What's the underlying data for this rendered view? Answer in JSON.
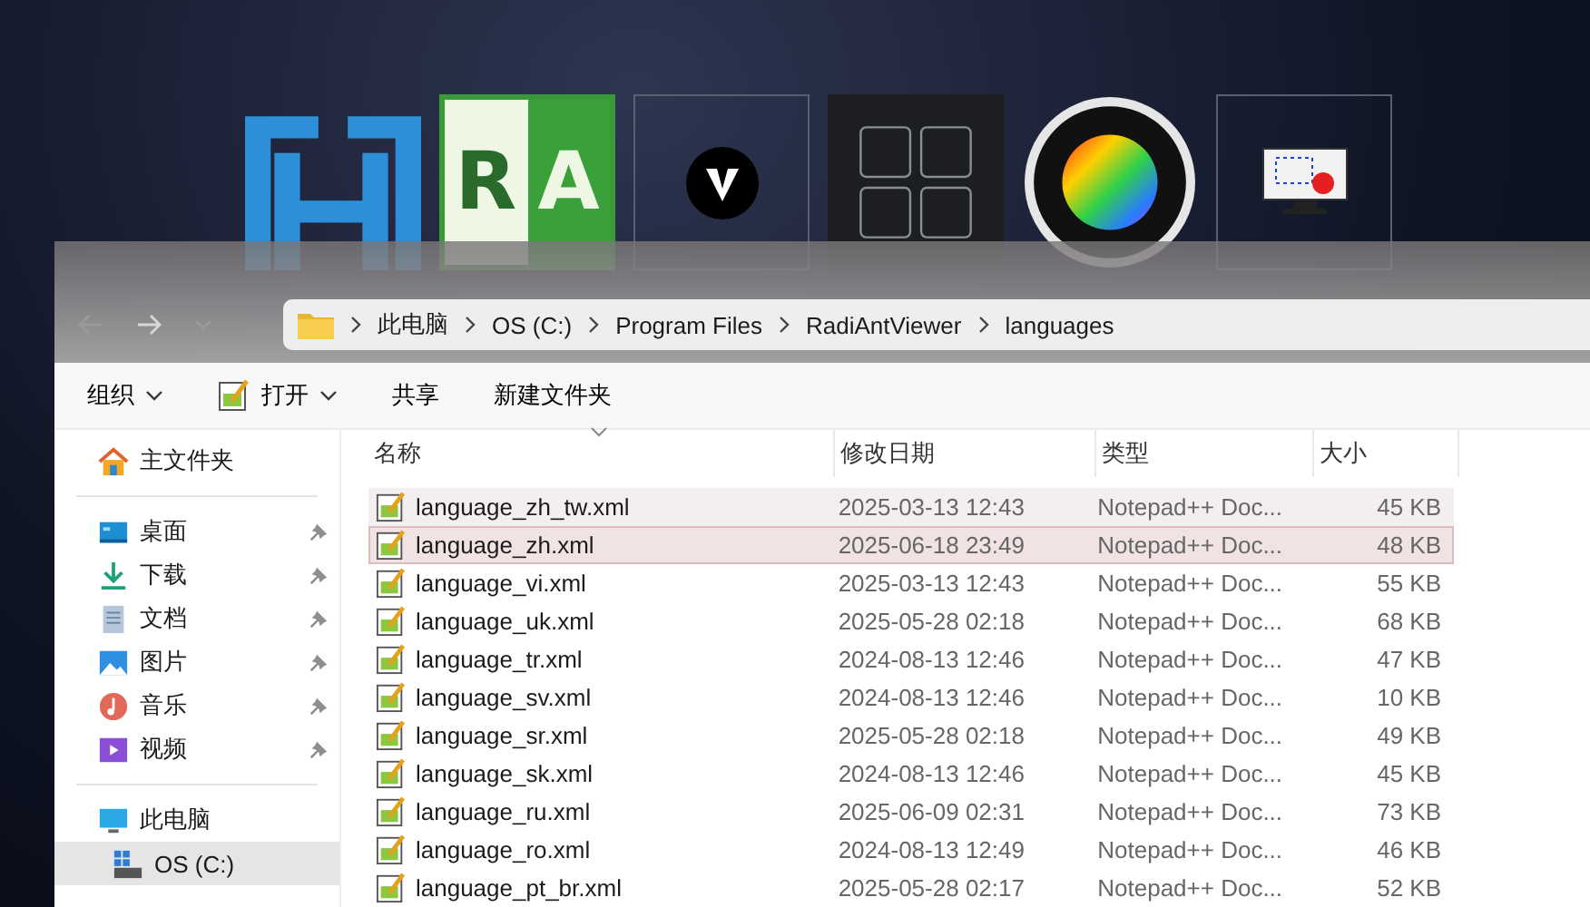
{
  "taskbar_previews": [
    {
      "kind": "h-logo"
    },
    {
      "kind": "ra-logo",
      "text_left": "R",
      "text_right": "A"
    },
    {
      "kind": "v-logo"
    },
    {
      "kind": "grid-logo"
    },
    {
      "kind": "color-wheel"
    },
    {
      "kind": "screen-capture"
    }
  ],
  "address_bar": {
    "crumbs": [
      "此电脑",
      "OS (C:)",
      "Program Files",
      "RadiAntViewer",
      "languages"
    ]
  },
  "toolbar": [
    {
      "label": "组织",
      "kind": "menu"
    },
    {
      "label": "打开",
      "kind": "open"
    },
    {
      "label": "共享",
      "kind": "plain"
    },
    {
      "label": "新建文件夹",
      "kind": "plain"
    }
  ],
  "sidebar": {
    "home": {
      "label": "主文件夹"
    },
    "quick_access": [
      {
        "label": "桌面",
        "kind": "desktop",
        "pinned": true
      },
      {
        "label": "下载",
        "kind": "download",
        "pinned": true
      },
      {
        "label": "文档",
        "kind": "documents",
        "pinned": true
      },
      {
        "label": "图片",
        "kind": "pictures",
        "pinned": true
      },
      {
        "label": "音乐",
        "kind": "music",
        "pinned": true
      },
      {
        "label": "视频",
        "kind": "videos",
        "pinned": true
      }
    ],
    "this_pc": {
      "label": "此电脑",
      "children": [
        {
          "label": "OS (C:)",
          "selected": true
        }
      ]
    }
  },
  "table": {
    "columns": [
      "名称",
      "修改日期",
      "类型",
      "大小"
    ],
    "rows": [
      {
        "name": "language_zh_tw.xml",
        "modified": "2025-03-13 12:43",
        "type": "Notepad++ Doc...",
        "size": "45 KB",
        "selected": false,
        "hovered": true
      },
      {
        "name": "language_zh.xml",
        "modified": "2025-06-18 23:49",
        "type": "Notepad++ Doc...",
        "size": "48 KB",
        "selected": true,
        "hovered": false
      },
      {
        "name": "language_vi.xml",
        "modified": "2025-03-13 12:43",
        "type": "Notepad++ Doc...",
        "size": "55 KB",
        "selected": false,
        "hovered": false
      },
      {
        "name": "language_uk.xml",
        "modified": "2025-05-28 02:18",
        "type": "Notepad++ Doc...",
        "size": "68 KB",
        "selected": false,
        "hovered": false
      },
      {
        "name": "language_tr.xml",
        "modified": "2024-08-13 12:46",
        "type": "Notepad++ Doc...",
        "size": "47 KB",
        "selected": false,
        "hovered": false
      },
      {
        "name": "language_sv.xml",
        "modified": "2024-08-13 12:46",
        "type": "Notepad++ Doc...",
        "size": "10 KB",
        "selected": false,
        "hovered": false
      },
      {
        "name": "language_sr.xml",
        "modified": "2025-05-28 02:18",
        "type": "Notepad++ Doc...",
        "size": "49 KB",
        "selected": false,
        "hovered": false
      },
      {
        "name": "language_sk.xml",
        "modified": "2024-08-13 12:46",
        "type": "Notepad++ Doc...",
        "size": "45 KB",
        "selected": false,
        "hovered": false
      },
      {
        "name": "language_ru.xml",
        "modified": "2025-06-09 02:31",
        "type": "Notepad++ Doc...",
        "size": "73 KB",
        "selected": false,
        "hovered": false
      },
      {
        "name": "language_ro.xml",
        "modified": "2024-08-13 12:49",
        "type": "Notepad++ Doc...",
        "size": "46 KB",
        "selected": false,
        "hovered": false
      },
      {
        "name": "language_pt_br.xml",
        "modified": "2025-05-28 02:17",
        "type": "Notepad++ Doc...",
        "size": "52 KB",
        "selected": false,
        "hovered": false
      }
    ]
  }
}
